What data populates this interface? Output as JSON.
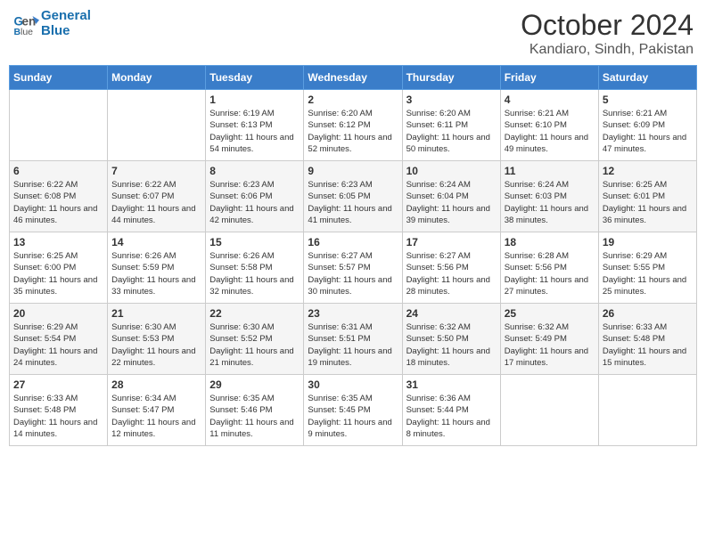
{
  "header": {
    "logo_line1": "General",
    "logo_line2": "Blue",
    "title": "October 2024",
    "subtitle": "Kandiaro, Sindh, Pakistan"
  },
  "columns": [
    "Sunday",
    "Monday",
    "Tuesday",
    "Wednesday",
    "Thursday",
    "Friday",
    "Saturday"
  ],
  "weeks": [
    {
      "days": [
        {
          "num": "",
          "sunrise": "",
          "sunset": "",
          "daylight": ""
        },
        {
          "num": "",
          "sunrise": "",
          "sunset": "",
          "daylight": ""
        },
        {
          "num": "1",
          "sunrise": "Sunrise: 6:19 AM",
          "sunset": "Sunset: 6:13 PM",
          "daylight": "Daylight: 11 hours and 54 minutes."
        },
        {
          "num": "2",
          "sunrise": "Sunrise: 6:20 AM",
          "sunset": "Sunset: 6:12 PM",
          "daylight": "Daylight: 11 hours and 52 minutes."
        },
        {
          "num": "3",
          "sunrise": "Sunrise: 6:20 AM",
          "sunset": "Sunset: 6:11 PM",
          "daylight": "Daylight: 11 hours and 50 minutes."
        },
        {
          "num": "4",
          "sunrise": "Sunrise: 6:21 AM",
          "sunset": "Sunset: 6:10 PM",
          "daylight": "Daylight: 11 hours and 49 minutes."
        },
        {
          "num": "5",
          "sunrise": "Sunrise: 6:21 AM",
          "sunset": "Sunset: 6:09 PM",
          "daylight": "Daylight: 11 hours and 47 minutes."
        }
      ]
    },
    {
      "days": [
        {
          "num": "6",
          "sunrise": "Sunrise: 6:22 AM",
          "sunset": "Sunset: 6:08 PM",
          "daylight": "Daylight: 11 hours and 46 minutes."
        },
        {
          "num": "7",
          "sunrise": "Sunrise: 6:22 AM",
          "sunset": "Sunset: 6:07 PM",
          "daylight": "Daylight: 11 hours and 44 minutes."
        },
        {
          "num": "8",
          "sunrise": "Sunrise: 6:23 AM",
          "sunset": "Sunset: 6:06 PM",
          "daylight": "Daylight: 11 hours and 42 minutes."
        },
        {
          "num": "9",
          "sunrise": "Sunrise: 6:23 AM",
          "sunset": "Sunset: 6:05 PM",
          "daylight": "Daylight: 11 hours and 41 minutes."
        },
        {
          "num": "10",
          "sunrise": "Sunrise: 6:24 AM",
          "sunset": "Sunset: 6:04 PM",
          "daylight": "Daylight: 11 hours and 39 minutes."
        },
        {
          "num": "11",
          "sunrise": "Sunrise: 6:24 AM",
          "sunset": "Sunset: 6:03 PM",
          "daylight": "Daylight: 11 hours and 38 minutes."
        },
        {
          "num": "12",
          "sunrise": "Sunrise: 6:25 AM",
          "sunset": "Sunset: 6:01 PM",
          "daylight": "Daylight: 11 hours and 36 minutes."
        }
      ]
    },
    {
      "days": [
        {
          "num": "13",
          "sunrise": "Sunrise: 6:25 AM",
          "sunset": "Sunset: 6:00 PM",
          "daylight": "Daylight: 11 hours and 35 minutes."
        },
        {
          "num": "14",
          "sunrise": "Sunrise: 6:26 AM",
          "sunset": "Sunset: 5:59 PM",
          "daylight": "Daylight: 11 hours and 33 minutes."
        },
        {
          "num": "15",
          "sunrise": "Sunrise: 6:26 AM",
          "sunset": "Sunset: 5:58 PM",
          "daylight": "Daylight: 11 hours and 32 minutes."
        },
        {
          "num": "16",
          "sunrise": "Sunrise: 6:27 AM",
          "sunset": "Sunset: 5:57 PM",
          "daylight": "Daylight: 11 hours and 30 minutes."
        },
        {
          "num": "17",
          "sunrise": "Sunrise: 6:27 AM",
          "sunset": "Sunset: 5:56 PM",
          "daylight": "Daylight: 11 hours and 28 minutes."
        },
        {
          "num": "18",
          "sunrise": "Sunrise: 6:28 AM",
          "sunset": "Sunset: 5:56 PM",
          "daylight": "Daylight: 11 hours and 27 minutes."
        },
        {
          "num": "19",
          "sunrise": "Sunrise: 6:29 AM",
          "sunset": "Sunset: 5:55 PM",
          "daylight": "Daylight: 11 hours and 25 minutes."
        }
      ]
    },
    {
      "days": [
        {
          "num": "20",
          "sunrise": "Sunrise: 6:29 AM",
          "sunset": "Sunset: 5:54 PM",
          "daylight": "Daylight: 11 hours and 24 minutes."
        },
        {
          "num": "21",
          "sunrise": "Sunrise: 6:30 AM",
          "sunset": "Sunset: 5:53 PM",
          "daylight": "Daylight: 11 hours and 22 minutes."
        },
        {
          "num": "22",
          "sunrise": "Sunrise: 6:30 AM",
          "sunset": "Sunset: 5:52 PM",
          "daylight": "Daylight: 11 hours and 21 minutes."
        },
        {
          "num": "23",
          "sunrise": "Sunrise: 6:31 AM",
          "sunset": "Sunset: 5:51 PM",
          "daylight": "Daylight: 11 hours and 19 minutes."
        },
        {
          "num": "24",
          "sunrise": "Sunrise: 6:32 AM",
          "sunset": "Sunset: 5:50 PM",
          "daylight": "Daylight: 11 hours and 18 minutes."
        },
        {
          "num": "25",
          "sunrise": "Sunrise: 6:32 AM",
          "sunset": "Sunset: 5:49 PM",
          "daylight": "Daylight: 11 hours and 17 minutes."
        },
        {
          "num": "26",
          "sunrise": "Sunrise: 6:33 AM",
          "sunset": "Sunset: 5:48 PM",
          "daylight": "Daylight: 11 hours and 15 minutes."
        }
      ]
    },
    {
      "days": [
        {
          "num": "27",
          "sunrise": "Sunrise: 6:33 AM",
          "sunset": "Sunset: 5:48 PM",
          "daylight": "Daylight: 11 hours and 14 minutes."
        },
        {
          "num": "28",
          "sunrise": "Sunrise: 6:34 AM",
          "sunset": "Sunset: 5:47 PM",
          "daylight": "Daylight: 11 hours and 12 minutes."
        },
        {
          "num": "29",
          "sunrise": "Sunrise: 6:35 AM",
          "sunset": "Sunset: 5:46 PM",
          "daylight": "Daylight: 11 hours and 11 minutes."
        },
        {
          "num": "30",
          "sunrise": "Sunrise: 6:35 AM",
          "sunset": "Sunset: 5:45 PM",
          "daylight": "Daylight: 11 hours and 9 minutes."
        },
        {
          "num": "31",
          "sunrise": "Sunrise: 6:36 AM",
          "sunset": "Sunset: 5:44 PM",
          "daylight": "Daylight: 11 hours and 8 minutes."
        },
        {
          "num": "",
          "sunrise": "",
          "sunset": "",
          "daylight": ""
        },
        {
          "num": "",
          "sunrise": "",
          "sunset": "",
          "daylight": ""
        }
      ]
    }
  ]
}
